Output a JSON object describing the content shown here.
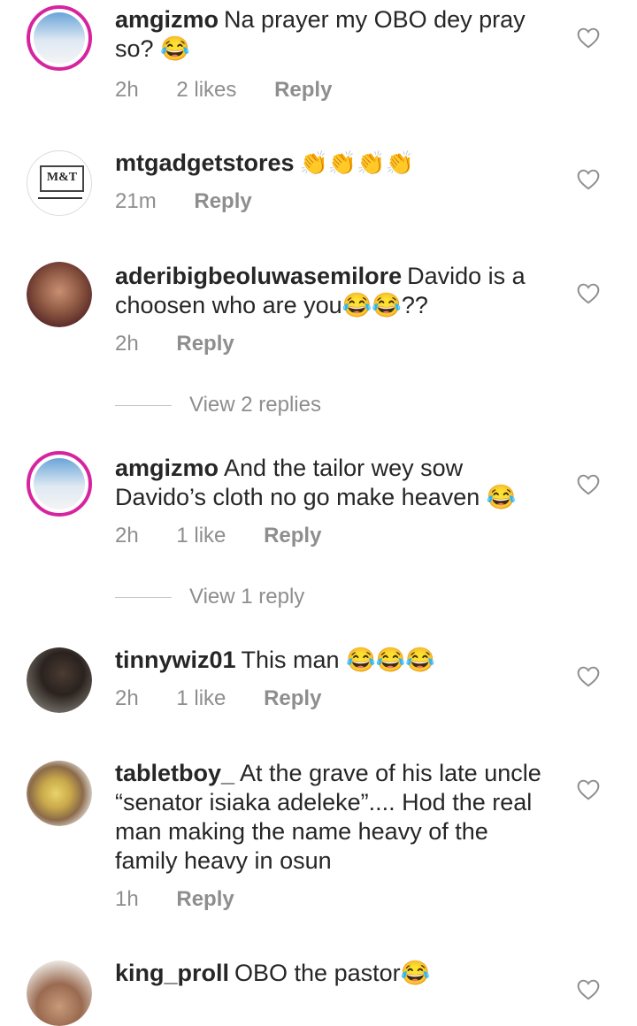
{
  "comments": [
    {
      "user": "amgizmo",
      "text": "Na prayer my OBO dey pray so? 😂",
      "time": "2h",
      "likes": "2 likes",
      "reply": "Reply"
    },
    {
      "user": "mtgadgetstores",
      "text": "👏👏👏👏",
      "time": "21m",
      "likes": "",
      "reply": "Reply",
      "logo": "M&T"
    },
    {
      "user": "aderibigbeoluwasemilore",
      "text": "Davido is a choosen who are you😂😂??",
      "time": "2h",
      "likes": "",
      "reply": "Reply",
      "view_replies": "View 2 replies"
    },
    {
      "user": "amgizmo",
      "text": "And the tailor wey sow Davido’s cloth no go make heaven 😂",
      "time": "2h",
      "likes": "1 like",
      "reply": "Reply",
      "view_replies": "View 1 reply"
    },
    {
      "user": "tinnywiz01",
      "text": "This man 😂😂😂",
      "time": "2h",
      "likes": "1 like",
      "reply": "Reply"
    },
    {
      "user": "tabletboy_",
      "text": "At the grave of his late uncle “senator isiaka adeleke”.... Hod the real man making the name heavy of the family heavy in osun",
      "time": "1h",
      "likes": "",
      "reply": "Reply"
    },
    {
      "user": "king_proll",
      "text": "OBO the pastor😂",
      "time": "",
      "likes": "",
      "reply": ""
    }
  ]
}
